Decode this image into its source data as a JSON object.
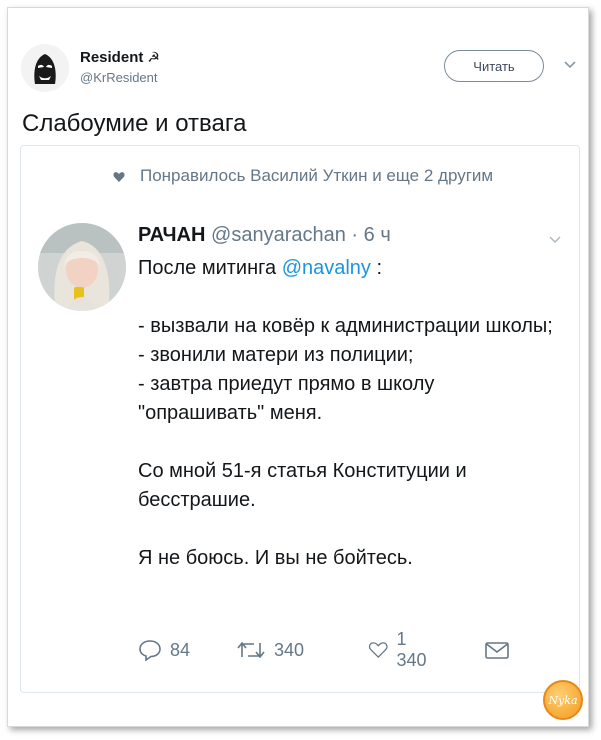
{
  "header": {
    "author_name": "Resident",
    "author_flag": "☭",
    "author_handle": "@KrResident",
    "follow_label": "Читать"
  },
  "tweet": {
    "text": "Слабоумие и отвага"
  },
  "quoted": {
    "liked_by": "Понравилось Василий Уткин и еще 2 другим",
    "name": "РАЧАН",
    "handle": "@sanyarachan",
    "separator": "·",
    "time": "6 ч",
    "line1_prefix": "После митинга",
    "line1_mention": "@navalny",
    "line1_suffix": ":",
    "list": [
      "- вызвали на ковёр к администрации школы;",
      "- звонили матери из полиции;",
      "- завтра приедут прямо в школу \"опрашивать\" меня."
    ],
    "para2": "Со мной 51-я статья Конституции и бесстрашие.",
    "para3": "Я не боюсь. И вы не бойтесь.",
    "actions": {
      "replies": "84",
      "retweets": "340",
      "likes": "1 340"
    }
  },
  "watermark": {
    "text": "Nyka"
  },
  "icons": {
    "reply": "reply-icon",
    "retweet": "retweet-icon",
    "like": "heart-icon",
    "dm": "envelope-icon",
    "chevron": "chevron-down-icon"
  },
  "colors": {
    "link": "#1b95e0",
    "muted": "#657786",
    "text": "#14171a"
  }
}
